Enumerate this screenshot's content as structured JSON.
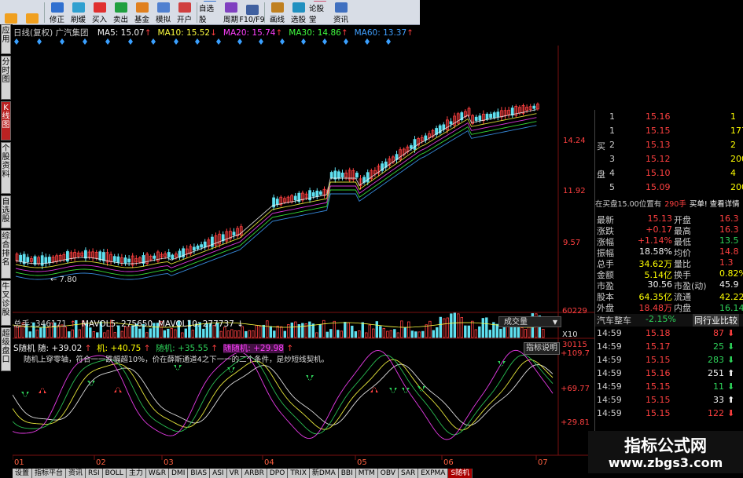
{
  "toolbar": {
    "buttons": [
      {
        "label": "",
        "icon": "back-icon"
      },
      {
        "label": "",
        "icon": "forward-icon"
      },
      {
        "label": "修正",
        "icon": "edit-icon"
      },
      {
        "label": "刷缓",
        "icon": "refresh-icon"
      },
      {
        "label": "买入",
        "icon": "buy-icon"
      },
      {
        "label": "卖出",
        "icon": "sell-icon"
      },
      {
        "label": "基金",
        "icon": "fund-icon"
      },
      {
        "label": "模拟",
        "icon": "simulate-icon"
      },
      {
        "label": "开户",
        "icon": "account-icon"
      },
      {
        "label": "自选股",
        "icon": "watchlist-icon"
      },
      {
        "label": "周期",
        "icon": "period-icon"
      },
      {
        "label": "F10/F9",
        "icon": "f10-icon"
      },
      {
        "label": "画线",
        "icon": "drawline-icon"
      },
      {
        "label": "选股",
        "icon": "stockpick-icon"
      },
      {
        "label": "论股堂",
        "icon": "forum-icon"
      },
      {
        "label": "资讯",
        "icon": "news-icon"
      }
    ]
  },
  "left_tabs": [
    "应用",
    "分时图",
    "K线图",
    "个股资料",
    "自选股",
    "综合排名",
    "牛叉诊股",
    "超级盘口"
  ],
  "ma_legend": {
    "title": "日线(复权) 广汽集团",
    "items": [
      {
        "text": "MA5: 15.07",
        "arrow": "↑",
        "color": "#f4f4f4"
      },
      {
        "text": "MA10: 15.52",
        "arrow": "↓",
        "color": "#ffff40"
      },
      {
        "text": "MA20: 15.74",
        "arrow": "↑",
        "color": "#ff40ff"
      },
      {
        "text": "MA30: 14.86",
        "arrow": "↑",
        "color": "#40ff40"
      },
      {
        "text": "MA60: 13.37",
        "arrow": "↑",
        "color": "#40a0ff"
      }
    ]
  },
  "price_axis": {
    "labels": [
      "14.24",
      "11.92",
      "9.57"
    ]
  },
  "low_marker": "7.80",
  "volume_legend": {
    "total": "总手: 346171",
    "arrow1": "↑",
    "mavol5": "MAVOL5: 275650",
    "mavol10": "MAVOL10: 277737",
    "arrow2": "↓",
    "dropdown": "成交量",
    "axis": [
      "60229",
      "30115",
      "X10"
    ]
  },
  "indicator_legend": {
    "name": "S随机",
    "s1": "随: +39.02",
    "s2": "机: +40.75",
    "s3": "随机: +35.55",
    "s4": "随随机: +29.98",
    "button": "指标说明",
    "description": "随机上穿零轴，符合一一跌幅超10%，价在薛斯通道4之下一一的二个条件，是炒短线契机。",
    "axis": [
      "+109.7",
      "+69.77",
      "+29.81"
    ]
  },
  "date_axis": [
    "01",
    "02",
    "03",
    "04",
    "05",
    "06",
    "07"
  ],
  "order_book": {
    "sell_label": "卖盘",
    "buy_label": "买盘",
    "rows": [
      {
        "side": "",
        "idx": "1",
        "price": "15.16",
        "vol": "1"
      },
      {
        "side": "",
        "idx": "1",
        "price": "15.15",
        "vol": "1770"
      },
      {
        "side": "买",
        "idx": "2",
        "price": "15.13",
        "vol": "2"
      },
      {
        "side": "",
        "idx": "3",
        "price": "15.12",
        "vol": "200"
      },
      {
        "side": "盘",
        "idx": "4",
        "price": "15.10",
        "vol": "4"
      },
      {
        "side": "",
        "idx": "5",
        "price": "15.09",
        "vol": "200"
      }
    ],
    "banner_left": "在买盘15.00位置有",
    "banner_vol": "290手",
    "banner_right": "买单! 查看详情"
  },
  "quotes": [
    {
      "l": "最新",
      "v": "15.13",
      "vc": "red",
      "r": "开盘",
      "rv": "16.3",
      "rc": "red"
    },
    {
      "l": "涨跌",
      "v": "+0.17",
      "vc": "red",
      "r": "最高",
      "rv": "16.3",
      "rc": "red"
    },
    {
      "l": "涨幅",
      "v": "+1.14%",
      "vc": "red",
      "r": "最低",
      "rv": "13.5",
      "rc": "grn"
    },
    {
      "l": "振幅",
      "v": "18.58%",
      "vc": "wht",
      "r": "均价",
      "rv": "14.8",
      "rc": "red"
    },
    {
      "l": "总手",
      "v": "34.62万",
      "vc": "yel",
      "r": "量比",
      "rv": "1.3",
      "rc": "red"
    },
    {
      "l": "金额",
      "v": "5.14亿",
      "vc": "yel",
      "r": "换手",
      "rv": "0.82%",
      "rc": "yel"
    },
    {
      "l": "市盈",
      "v": "30.56",
      "vc": "wht",
      "r": "市盈(动)",
      "rv": "45.9",
      "rc": "wht"
    },
    {
      "l": "股本",
      "v": "64.35亿",
      "vc": "yel",
      "r": "流通",
      "rv": "42.22亿",
      "rc": "yel"
    },
    {
      "l": "外盘",
      "v": "18.48万",
      "vc": "red",
      "r": "内盘",
      "rv": "16.14万",
      "rc": "grn"
    }
  ],
  "sector": {
    "name": "汽车整车",
    "change": "-2.15%",
    "button": "同行业比较"
  },
  "ticks": [
    {
      "t": "14:59",
      "p": "15.18",
      "pc": "red",
      "v": "87",
      "vc": "red",
      "a": "⬇",
      "ac": "red"
    },
    {
      "t": "14:59",
      "p": "15.17",
      "pc": "red",
      "v": "25",
      "vc": "grn",
      "a": "⬇",
      "ac": "grn"
    },
    {
      "t": "14:59",
      "p": "15.15",
      "pc": "red",
      "v": "283",
      "vc": "grn",
      "a": "⬇",
      "ac": "grn"
    },
    {
      "t": "14:59",
      "p": "15.16",
      "pc": "red",
      "v": "251",
      "vc": "wht",
      "a": "⬆",
      "ac": "wht"
    },
    {
      "t": "14:59",
      "p": "15.15",
      "pc": "red",
      "v": "11",
      "vc": "grn",
      "a": "⬇",
      "ac": "grn"
    },
    {
      "t": "14:59",
      "p": "15.15",
      "pc": "red",
      "v": "33",
      "vc": "wht",
      "a": "⬆",
      "ac": "wht"
    },
    {
      "t": "14:59",
      "p": "15.15",
      "pc": "red",
      "v": "122",
      "vc": "red",
      "a": "⬇",
      "ac": "red"
    }
  ],
  "bottom_tabs": [
    "设置",
    "指标平台",
    "资讯",
    "RSI",
    "BOLL",
    "主力",
    "W&R",
    "DMI",
    "BIAS",
    "ASI",
    "VR",
    "ARBR",
    "DPO",
    "TRIX",
    "新DMA",
    "BBI",
    "MTM",
    "OBV",
    "SAR",
    "EXPMA",
    "S随机"
  ],
  "watermark": {
    "title": "指标公式网",
    "url": "www.zbgs3.com"
  },
  "colors": {
    "up": "#ff4040",
    "down": "#2ed35a",
    "volume_bar": "#5fe0f0",
    "background": "#000000"
  }
}
